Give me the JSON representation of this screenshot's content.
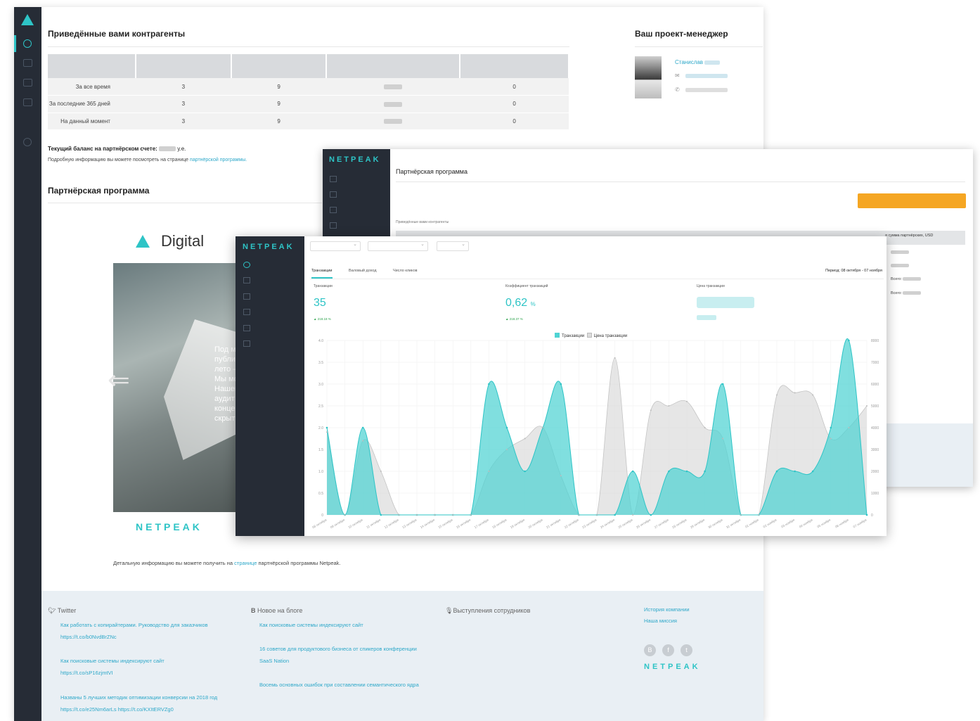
{
  "main": {
    "referrals_title": "Приведённые вами контрагенты",
    "table": {
      "headers": [
        "",
        "",
        "",
        "",
        ""
      ],
      "rows": [
        {
          "label": "За все время",
          "c1": "3",
          "c2": "9",
          "c4": "0"
        },
        {
          "label": "За последние 365 дней",
          "c1": "3",
          "c2": "9",
          "c4": "0"
        },
        {
          "label": "На данный момент",
          "c1": "3",
          "c2": "9",
          "c4": "0"
        }
      ]
    },
    "balance_label": "Текущий баланс на партнёрском счете:",
    "balance_unit": "у.е.",
    "more_info_text": "Подробную информацию вы можете посмотреть на странице",
    "more_info_link": "партнёрской программы.",
    "pm_title": "Ваш проект-менеджер",
    "pm_name": "Станислав",
    "partner_title": "Партнёрская программа",
    "digital": "Digital",
    "photo_text": "Под м\nпубли\nлето –\nМы мс\nНашей\nаудит\nконце\nскрыт",
    "arrow": "⇐",
    "netpeak_logo": "NETPEAK",
    "detail_text": "Детальную информацию вы можете получить на",
    "detail_link": "странице",
    "detail_tail": "партнёрской программы Netpeak."
  },
  "footer": {
    "twitter_title": "Twitter",
    "twitter_links": [
      "Как работать с копирайтерами. Руководство для заказчиков",
      "https://t.co/b0NvdBrZNc",
      "Как поисковые системы индексируют сайт",
      "https://t.co/sP16zjmtVI",
      "Названы 5 лучших методик оптимизации конверсии на 2018 год",
      "https://t.co/e25Nm6arLs https://t.co/KXItERVZg0"
    ],
    "blog_title": "Новое на блоге",
    "blog_links": [
      "Как поисковые системы индексируют сайт",
      "16 советов для продуктового бизнеса от спикеров конференции",
      "SaaS Nation",
      "Восемь основных ошибок при составлении семантического ядра"
    ],
    "talks_title": "Выступления сотрудников",
    "company_links": [
      "История компании",
      "Наша миссия"
    ],
    "social": [
      "B",
      "f",
      "t"
    ],
    "logo": "NETPEAK"
  },
  "mid": {
    "logo": "NETPEAK",
    "logo_sub": "",
    "side_items": [
      "",
      "",
      "",
      ""
    ],
    "title": "Партнёрская программа",
    "orange_button": "",
    "sublabel": "Приведённые вами контрагенты",
    "right_col_header": "я сумма партнёрских, USD",
    "total_label": "Всего:"
  },
  "front": {
    "logo": "NETPEAK",
    "logo_sub": "",
    "side_items": [
      "",
      "",
      "",
      "",
      "",
      ""
    ],
    "dropdowns": [
      "",
      "",
      ""
    ],
    "note": "",
    "tabs": [
      "Транзакции",
      "Валовый доход",
      "Число кликов"
    ],
    "period": "Период: 08 октября - 07 ноября",
    "metrics": [
      {
        "label": "Транзакции",
        "value": "35",
        "unit": "",
        "delta": "▲ 218.18 %"
      },
      {
        "label": "Коэффициент транзакций",
        "value": "0,62",
        "unit": "%",
        "delta": "▲ 218.37 %"
      },
      {
        "label": "Цена транзакции",
        "value": "",
        "unit": "",
        "delta": ""
      }
    ]
  },
  "chart_data": {
    "type": "area",
    "legend": [
      "Транзакции",
      "Цена транзакции"
    ],
    "colors": {
      "transactions": "#4fd3d3",
      "price": "#dcdcdc"
    },
    "y_left": {
      "min": 0,
      "max": 4,
      "ticks": [
        "0",
        "0.5",
        "1.0",
        "1.5",
        "2.0",
        "2.5",
        "3.0",
        "3.5",
        "4.0"
      ]
    },
    "y_right": {
      "min": 0,
      "max": 8000,
      "ticks": [
        "0",
        "1000",
        "2000",
        "3000",
        "4000",
        "5000",
        "6000",
        "7000",
        "8000"
      ]
    },
    "x": [
      "08 октября",
      "09 октября",
      "10 октября",
      "11 октября",
      "12 октября",
      "13 октября",
      "14 октября",
      "15 октября",
      "16 октября",
      "17 октября",
      "18 октября",
      "19 октября",
      "20 октября",
      "21 октября",
      "22 октября",
      "23 октября",
      "24 октября",
      "25 октября",
      "26 октября",
      "27 октября",
      "28 октября",
      "29 октября",
      "30 октября",
      "31 октября",
      "01 ноября",
      "02 ноября",
      "03 ноября",
      "04 ноября",
      "05 ноября",
      "06 ноября",
      "07 ноября"
    ],
    "series": [
      {
        "name": "Транзакции",
        "axis": "left",
        "values": [
          2,
          0,
          2,
          0,
          0,
          0,
          0,
          0,
          0,
          3,
          2,
          1,
          2,
          3,
          0,
          0,
          0,
          1,
          0,
          1,
          1,
          1,
          3,
          0,
          0,
          1,
          1,
          1,
          2,
          4,
          0
        ]
      },
      {
        "name": "Цена транзакции",
        "axis": "right",
        "values": [
          3800,
          0,
          3400,
          2000,
          0,
          0,
          0,
          0,
          0,
          2000,
          3000,
          3500,
          4000,
          1800,
          0,
          0,
          7200,
          0,
          4800,
          5000,
          5200,
          4000,
          3500,
          0,
          0,
          5500,
          5600,
          5500,
          3500,
          4000,
          5000
        ]
      }
    ]
  }
}
